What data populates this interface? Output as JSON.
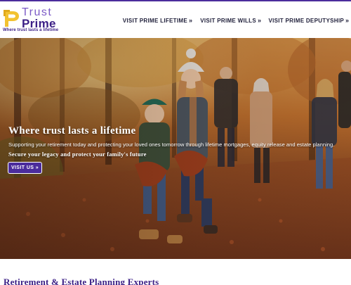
{
  "brand": {
    "name_top": "Trust",
    "name_bottom": "Prime",
    "tagline": "Where trust lasts a lifetime",
    "colors": {
      "primary": "#3b1f86",
      "accent": "#7c5bc7",
      "logo_mark": "#f2c230"
    }
  },
  "nav": {
    "items": [
      {
        "label": "VISIT PRIME LIFETIME",
        "icon": "double-chevron-right-icon"
      },
      {
        "label": "VISIT PRIME WILLS",
        "icon": "double-chevron-right-icon"
      },
      {
        "label": "VISIT PRIME DEPUTYSHIP",
        "icon": "double-chevron-right-icon"
      }
    ],
    "chevron": "»"
  },
  "hero": {
    "title": "Where trust lasts a lifetime",
    "subtitle": "Supporting your retirement today and protecting your loved ones tomorrow through lifetime mortgages, equity release and estate planning.",
    "tagline": "Secure your legacy and protect your family's future",
    "button_label": "VISIT US »",
    "image_alt": "family-walking-autumn-leaves"
  },
  "section": {
    "title": "Retirement & Estate Planning Experts"
  }
}
